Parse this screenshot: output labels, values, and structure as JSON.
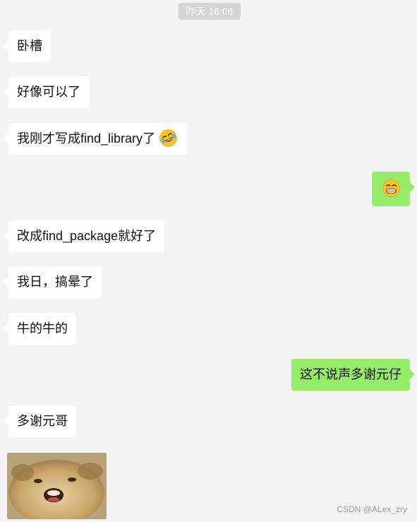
{
  "timestamp": "昨天 16:08",
  "messages": [
    {
      "id": "m1",
      "side": "in",
      "text": "卧槽"
    },
    {
      "id": "m2",
      "side": "in",
      "text": "好像可以了"
    },
    {
      "id": "m3",
      "side": "in",
      "text": "我刚才写成find_library了",
      "emoji": "rofl-emoji"
    },
    {
      "id": "m4",
      "side": "out",
      "emoji": "grin-emoji"
    },
    {
      "id": "m5",
      "side": "in",
      "text": "改成find_package就好了"
    },
    {
      "id": "m6",
      "side": "in",
      "text": "我日，搞晕了"
    },
    {
      "id": "m7",
      "side": "in",
      "text": "牛的牛的"
    },
    {
      "id": "m8",
      "side": "out",
      "text": "这不说声多谢元仔"
    },
    {
      "id": "m9",
      "side": "in",
      "text": "多谢元哥"
    },
    {
      "id": "m10",
      "side": "in",
      "sticker": "cat-face-sticker"
    }
  ],
  "watermark": "CSDN @ALex_zry",
  "colors": {
    "background": "#f4f4f4",
    "incoming_bubble": "#ffffff",
    "outgoing_bubble": "#95ec69",
    "timestamp_bg": "#d4d4d4"
  }
}
